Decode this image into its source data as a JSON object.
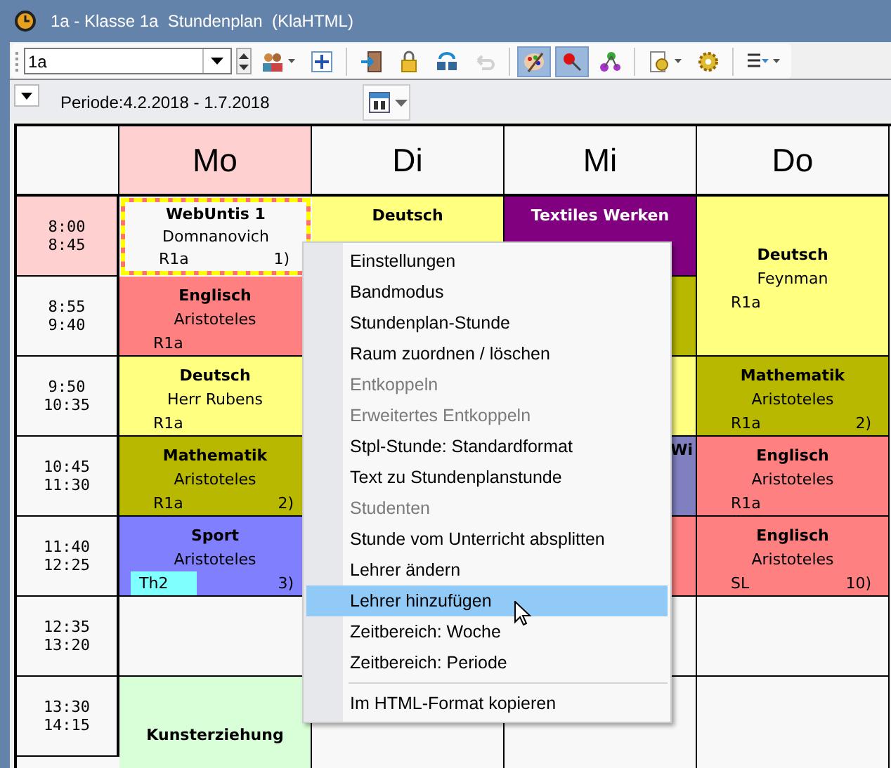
{
  "window": {
    "title": "1a - Klasse 1a  Stundenplan  (KlaHTML)"
  },
  "toolbar": {
    "class_value": "1a",
    "buttons": [
      {
        "pressed": false,
        "disabled": false,
        "dropdown": true
      },
      {
        "pressed": false,
        "disabled": false,
        "dropdown": false
      },
      {
        "pressed": false,
        "disabled": false,
        "dropdown": false
      },
      {
        "pressed": false,
        "disabled": false,
        "dropdown": false
      },
      {
        "pressed": false,
        "disabled": false,
        "dropdown": false
      },
      {
        "pressed": false,
        "disabled": true,
        "dropdown": false
      },
      {
        "pressed": true,
        "disabled": false,
        "dropdown": false
      },
      {
        "pressed": true,
        "disabled": false,
        "dropdown": false
      },
      {
        "pressed": false,
        "disabled": false,
        "dropdown": false
      },
      {
        "pressed": false,
        "disabled": false,
        "dropdown": true
      },
      {
        "pressed": false,
        "disabled": false,
        "dropdown": false
      },
      {
        "pressed": false,
        "disabled": false,
        "dropdown": true
      }
    ]
  },
  "period": "Periode:4.2.2018 - 1.7.2018",
  "timetable": {
    "days": [
      {
        "label": "Mo",
        "selected": true
      },
      {
        "label": "Di",
        "selected": false
      },
      {
        "label": "Mi",
        "selected": false
      },
      {
        "label": "Do",
        "selected": false
      }
    ],
    "periods": [
      {
        "start": "8:00",
        "end": "8:45",
        "selected": true
      },
      {
        "start": "8:55",
        "end": "9:40",
        "selected": false
      },
      {
        "start": "9:50",
        "end": "10:35",
        "selected": false
      },
      {
        "start": "10:45",
        "end": "11:30",
        "selected": false
      },
      {
        "start": "11:40",
        "end": "12:25",
        "selected": false
      },
      {
        "start": "12:35",
        "end": "13:20",
        "selected": false
      },
      {
        "start": "13:30",
        "end": "14:15",
        "selected": false
      }
    ],
    "columns": [
      [
        {
          "kind": "lesson",
          "subject": "WebUntis 1",
          "teacher": "Domnanovich",
          "room": "R1a",
          "number": "1)",
          "color": "#f8f8f8",
          "selected": true
        },
        {
          "kind": "lesson",
          "subject": "Englisch",
          "teacher": "Aristoteles",
          "room": "R1a",
          "color": "#ff8080",
          "selected": false
        },
        {
          "kind": "lesson",
          "subject": "Deutsch",
          "teacher": "Herr Rubens",
          "room": "R1a",
          "color": "#ffff80",
          "selected": false
        },
        {
          "kind": "lesson",
          "subject": "Mathematik",
          "teacher": "Aristoteles",
          "room": "R1a",
          "number": "2)",
          "color": "#b8b800",
          "selected": false
        },
        {
          "kind": "lesson",
          "subject": "Sport",
          "teacher": "Aristoteles",
          "room": "Th2",
          "room_highlighted": true,
          "number": "3)",
          "color": "#8080ff",
          "selected": false
        },
        {
          "kind": "empty"
        },
        {
          "kind": "lesson",
          "subject": "Kunsterziehung",
          "color": "#d8ffd8",
          "selected": false
        },
        {
          "kind": "continued"
        }
      ],
      [
        {
          "kind": "lesson",
          "subject": "Deutsch",
          "color": "#ffff80",
          "selected": false
        },
        {
          "kind": "empty"
        },
        {
          "kind": "empty"
        },
        {
          "kind": "empty"
        },
        {
          "kind": "empty"
        },
        {
          "kind": "empty"
        },
        {
          "kind": "empty"
        },
        {
          "kind": "continued"
        }
      ],
      [
        {
          "kind": "lesson",
          "subject": "Textiles Werken",
          "color": "#800080",
          "selected": false
        },
        {
          "kind": "empty",
          "color": "#b8b800"
        },
        {
          "kind": "empty",
          "color": "#ffff80"
        },
        {
          "kind": "partial",
          "subject": "Wi",
          "color": "#8080c0"
        },
        {
          "kind": "empty",
          "color": "#ff8080"
        },
        {
          "kind": "empty"
        },
        {
          "kind": "empty"
        },
        {
          "kind": "continued"
        }
      ],
      [
        {
          "kind": "lesson",
          "subject": "Deutsch",
          "teacher": "Feynman",
          "room": "R1a",
          "color": "#ffff80",
          "selected": false
        },
        {
          "kind": "continued"
        },
        {
          "kind": "lesson",
          "subject": "Mathematik",
          "teacher": "Aristoteles",
          "room": "R1a",
          "number": "2)",
          "color": "#b8b800",
          "selected": false
        },
        {
          "kind": "lesson",
          "subject": "Englisch",
          "teacher": "Aristoteles",
          "room": "R1a",
          "color": "#ff8080",
          "selected": false
        },
        {
          "kind": "lesson",
          "subject": "Englisch",
          "teacher": "Aristoteles",
          "room": "SL",
          "number": "10)",
          "color": "#ff8080",
          "selected": false
        },
        {
          "kind": "empty"
        },
        {
          "kind": "empty"
        },
        {
          "kind": "continued"
        }
      ]
    ]
  },
  "context_menu": [
    {
      "kind": "item",
      "label": "Einstellungen",
      "disabled": false,
      "selected": false
    },
    {
      "kind": "item",
      "label": "Bandmodus",
      "disabled": false,
      "selected": false
    },
    {
      "kind": "item",
      "label": "Stundenplan-Stunde",
      "disabled": false,
      "selected": false
    },
    {
      "kind": "item",
      "label": "Raum zuordnen / löschen",
      "disabled": false,
      "selected": false
    },
    {
      "kind": "item",
      "label": "Entkoppeln",
      "disabled": true,
      "selected": false
    },
    {
      "kind": "item",
      "label": "Erweitertes Entkoppeln",
      "disabled": true,
      "selected": false
    },
    {
      "kind": "item",
      "label": "Stpl-Stunde: Standardformat",
      "disabled": false,
      "selected": false
    },
    {
      "kind": "item",
      "label": "Text zu Stundenplanstunde",
      "disabled": false,
      "selected": false
    },
    {
      "kind": "item",
      "label": "Studenten",
      "disabled": true,
      "selected": false
    },
    {
      "kind": "item",
      "label": "Stunde vom Unterricht absplitten",
      "disabled": false,
      "selected": false
    },
    {
      "kind": "item",
      "label": "Lehrer ändern",
      "disabled": false,
      "selected": false
    },
    {
      "kind": "item",
      "label": "Lehrer hinzufügen",
      "disabled": false,
      "selected": true
    },
    {
      "kind": "item",
      "label": "Zeitbereich: Woche",
      "disabled": false,
      "selected": false
    },
    {
      "kind": "item",
      "label": "Zeitbereich: Periode",
      "disabled": false,
      "selected": false
    },
    {
      "kind": "separator"
    },
    {
      "kind": "item",
      "label": "Im HTML-Format kopieren",
      "disabled": false,
      "selected": false
    }
  ]
}
